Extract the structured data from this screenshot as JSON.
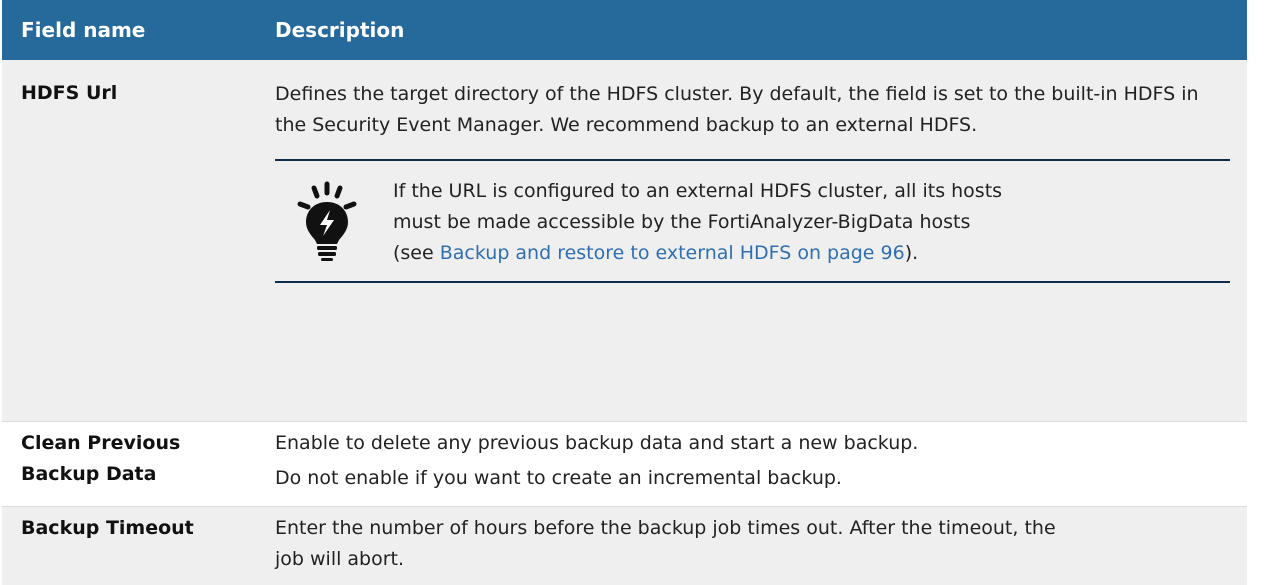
{
  "table": {
    "headers": {
      "field": "Field name",
      "description": "Description"
    },
    "rows": [
      {
        "field": "HDFS Url",
        "description": "Defines the target directory of the HDFS cluster. By default, the field is set to the built-in HDFS in the Security Event Manager. We recommend backup to an external HDFS.",
        "note": {
          "icon": "lightbulb-icon",
          "text_line1": "If the URL is configured to an external HDFS cluster, all its hosts",
          "text_line2": "must be made accessible by the FortiAnalyzer-BigData hosts",
          "text_prefix": "(see ",
          "link": "Backup and restore to external HDFS on page 96",
          "text_suffix": ")."
        }
      },
      {
        "field_line1": "Clean Previous",
        "field_line2": "Backup Data",
        "description_line1": "Enable to delete any previous backup data and start a new backup.",
        "description_line2": "Do not enable if you want to create an incremental backup."
      },
      {
        "field": "Backup Timeout",
        "description_line1": "Enter the number of hours before the backup job times out. After the timeout, the",
        "description_line2": "job will abort."
      }
    ]
  },
  "colors": {
    "header_bg": "#266a9b",
    "link": "#2f6fb0",
    "note_border": "#0e2d4c"
  }
}
